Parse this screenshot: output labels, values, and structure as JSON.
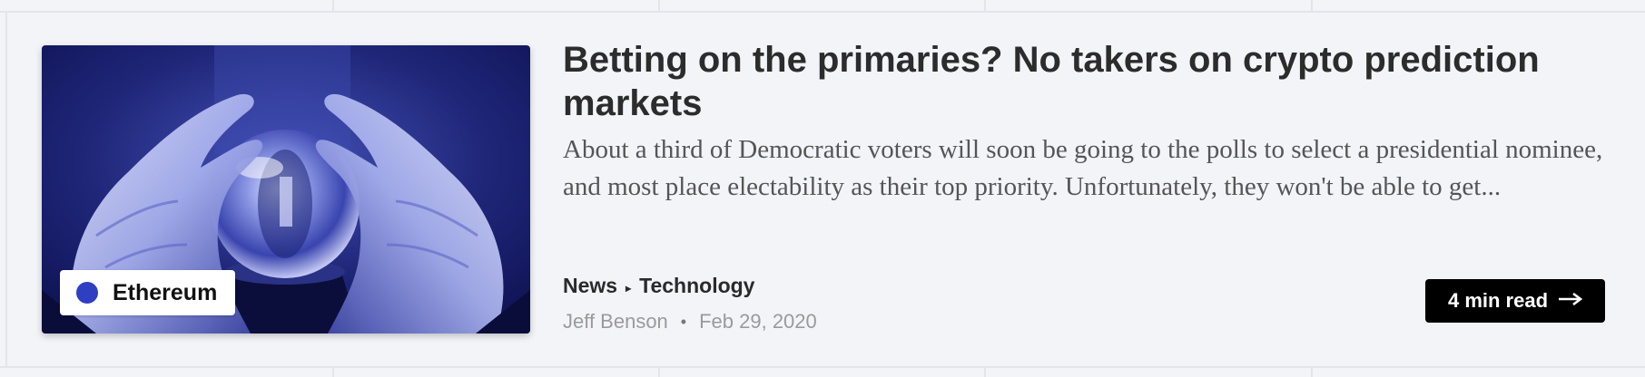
{
  "article": {
    "title": "Betting on the primaries? No takers on crypto prediction markets",
    "excerpt": "About a third of Democratic voters will soon be going to the polls to select a presidential nominee, and most place electability as their top priority. Unfortunately, they won't be able to get...",
    "tag": {
      "label": "Ethereum",
      "color": "#2f3fc2"
    },
    "breadcrumb": {
      "section": "News",
      "separator": "▸",
      "subsection": "Technology"
    },
    "author": "Jeff Benson",
    "meta_separator": "•",
    "date": "Feb 29, 2020",
    "read_button": {
      "label": "4 min read",
      "icon": "arrow-right-icon"
    },
    "thumbnail": {
      "subject": "crystal-ball-hands-image",
      "tint": "#2b3590"
    }
  }
}
